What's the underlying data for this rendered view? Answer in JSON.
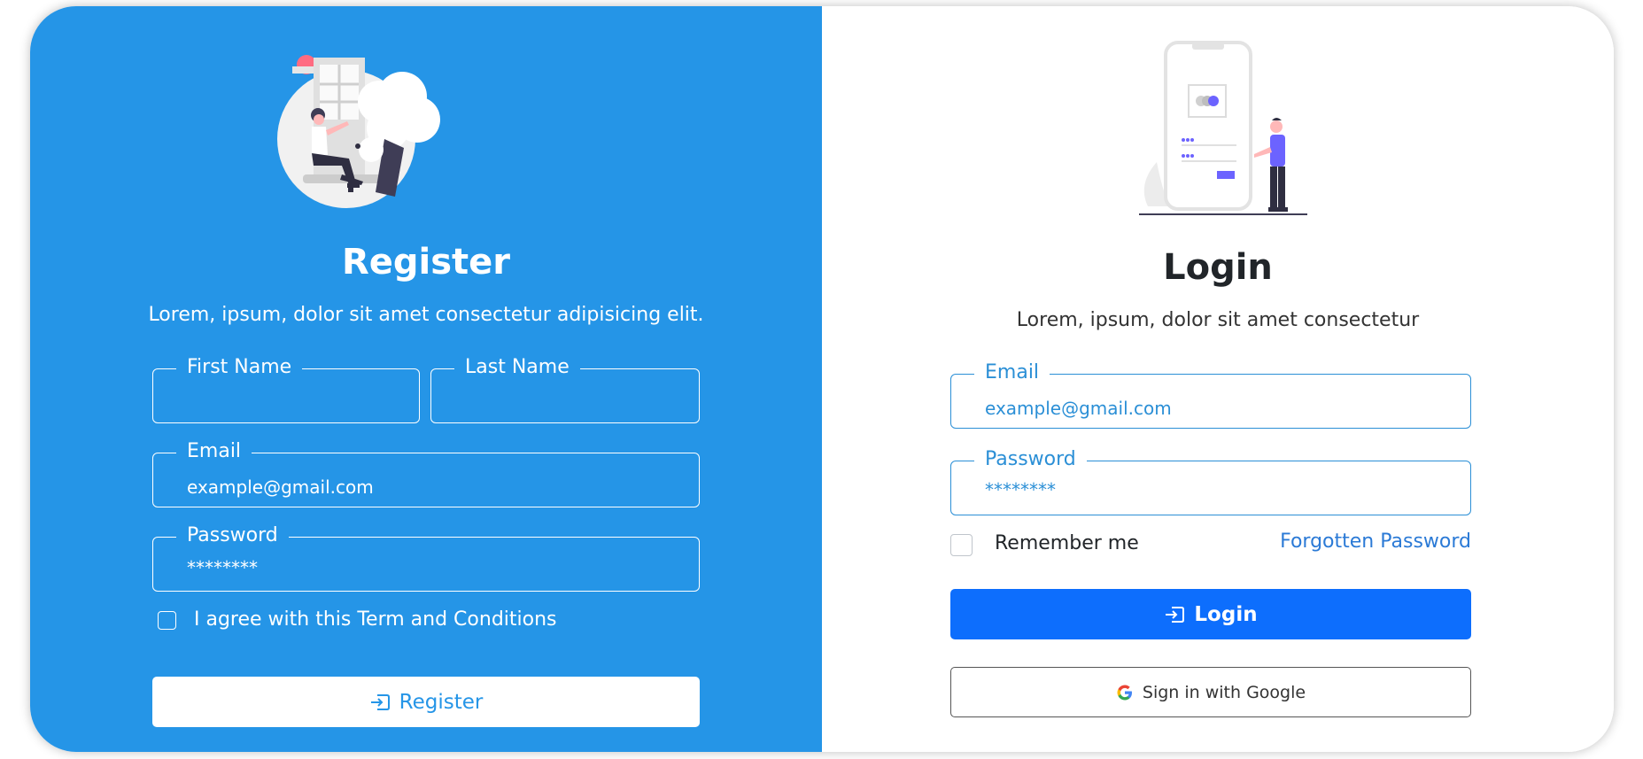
{
  "register": {
    "title": "Register",
    "subtitle": "Lorem, ipsum, dolor sit amet consectetur adipisicing elit.",
    "first_name_label": "First Name",
    "last_name_label": "Last Name",
    "email_label": "Email",
    "email_value": "example@gmail.com",
    "password_label": "Password",
    "password_value": "********",
    "terms_label": "I agree with this Term and Conditions",
    "button_label": "Register",
    "button_icon": "sign-in-icon",
    "illustration": "person-sitting-by-window-illustration"
  },
  "login": {
    "title": "Login",
    "subtitle": "Lorem, ipsum, dolor sit amet consectetur",
    "email_label": "Email",
    "email_value": "example@gmail.com",
    "password_label": "Password",
    "password_value": "********",
    "remember_label": "Remember me",
    "forgot_label": "Forgotten Password",
    "button_label": "Login",
    "button_icon": "sign-in-icon",
    "google_button_label": "Sign in with Google",
    "google_icon": "google-icon",
    "illustration": "person-with-phone-login-illustration"
  },
  "colors": {
    "left_panel_bg": "#2595e7",
    "primary_button": "#0d6efd",
    "field_accent": "#2b8fd6",
    "link": "#2b7ad6"
  }
}
